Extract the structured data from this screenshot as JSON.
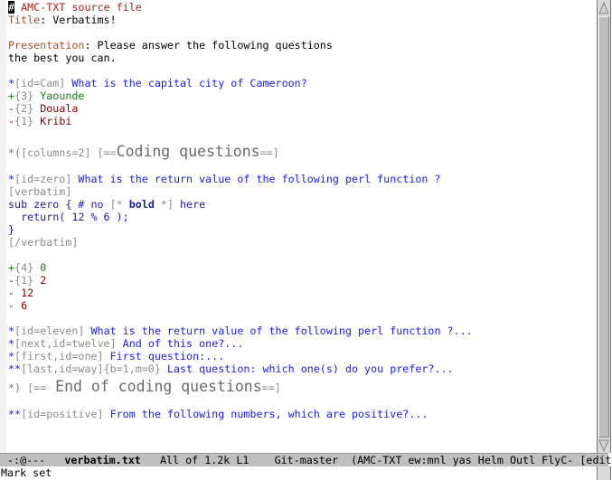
{
  "colors": {
    "question": "#1a1aff",
    "correct": "#1a7a1a",
    "wrong": "#8b0000",
    "comment": "#b22222",
    "keyword": "#a0522d",
    "code": "#1c1ca8",
    "options": "#8c8c8c"
  },
  "buffer": {
    "lines": [
      [
        {
          "t": "#",
          "c": "cur"
        },
        {
          "t": " AMC-TXT source file",
          "c": "r"
        }
      ],
      [
        {
          "t": "Title",
          "c": "k"
        },
        {
          "t": ": Verbatims!",
          "c": "t"
        }
      ],
      [],
      [
        {
          "t": "Presentation",
          "c": "k"
        },
        {
          "t": ": Please answer the following questions",
          "c": "t"
        }
      ],
      [
        {
          "t": "the best you can.",
          "c": "t"
        }
      ],
      [],
      [
        {
          "t": "*",
          "c": "q"
        },
        {
          "t": "[id=Cam]",
          "c": "o"
        },
        {
          "t": " What is the capital city of Cameroon?",
          "c": "q"
        }
      ],
      [
        {
          "t": "+",
          "c": "g"
        },
        {
          "t": "{3}",
          "c": "o"
        },
        {
          "t": " Yaounde",
          "c": "g"
        }
      ],
      [
        {
          "t": "-",
          "c": "w"
        },
        {
          "t": "{2}",
          "c": "o"
        },
        {
          "t": " Douala",
          "c": "w"
        }
      ],
      [
        {
          "t": "-",
          "c": "w"
        },
        {
          "t": "{1}",
          "c": "o"
        },
        {
          "t": " Kribi",
          "c": "w"
        }
      ],
      [],
      {
        "big": true,
        "segs": [
          {
            "t": "*(",
            "c": "ob"
          },
          {
            "t": "[columns=2]",
            "c": "o"
          },
          {
            "t": " [==",
            "c": "o"
          },
          {
            "t": "Coding questions",
            "c": "h"
          },
          {
            "t": "==]",
            "c": "o"
          }
        ]
      },
      [],
      [
        {
          "t": "*",
          "c": "q"
        },
        {
          "t": "[id=zero]",
          "c": "o"
        },
        {
          "t": " What is the return value of the following perl function ?",
          "c": "q"
        }
      ],
      [
        {
          "t": "[verbatim]",
          "c": "o"
        }
      ],
      [
        {
          "t": "sub zero { # no ",
          "c": "c"
        },
        {
          "t": "[*",
          "c": "o"
        },
        {
          "t": " bold ",
          "c": "cb"
        },
        {
          "t": "*]",
          "c": "o"
        },
        {
          "t": " here",
          "c": "c"
        }
      ],
      [
        {
          "t": "  return( 12 % 6 );",
          "c": "c"
        }
      ],
      [
        {
          "t": "}",
          "c": "c"
        }
      ],
      [
        {
          "t": "[/verbatim]",
          "c": "o"
        }
      ],
      [],
      [
        {
          "t": "+",
          "c": "g"
        },
        {
          "t": "{4}",
          "c": "o"
        },
        {
          "t": " 0",
          "c": "g"
        }
      ],
      [
        {
          "t": "-",
          "c": "w"
        },
        {
          "t": "{1}",
          "c": "o"
        },
        {
          "t": " 2",
          "c": "w"
        }
      ],
      [
        {
          "t": "-",
          "c": "w"
        },
        {
          "t": " 12",
          "c": "w"
        }
      ],
      [
        {
          "t": "-",
          "c": "w"
        },
        {
          "t": " 6",
          "c": "w"
        }
      ],
      [],
      [
        {
          "t": "*",
          "c": "q"
        },
        {
          "t": "[id=eleven]",
          "c": "o"
        },
        {
          "t": " What is the return value of the following perl function ?...",
          "c": "q"
        }
      ],
      [
        {
          "t": "*",
          "c": "q"
        },
        {
          "t": "[next,id=twelve]",
          "c": "o"
        },
        {
          "t": " And of this one?...",
          "c": "q"
        }
      ],
      [
        {
          "t": "*",
          "c": "q"
        },
        {
          "t": "[first,id=one]",
          "c": "o"
        },
        {
          "t": " First question:...",
          "c": "q"
        }
      ],
      [
        {
          "t": "**",
          "c": "q"
        },
        {
          "t": "[last,id=way]{b=1,m=0}",
          "c": "o"
        },
        {
          "t": " Last question: which one(s) do you prefer?...",
          "c": "q"
        }
      ],
      {
        "big": true,
        "segs": [
          {
            "t": "*)",
            "c": "ob"
          },
          {
            "t": " [==",
            "c": "o"
          },
          {
            "t": " End of coding questions",
            "c": "h"
          },
          {
            "t": "==]",
            "c": "o"
          }
        ]
      },
      [],
      [
        {
          "t": "**",
          "c": "q"
        },
        {
          "t": "[id=positive]",
          "c": "o"
        },
        {
          "t": " From the following numbers, which are positive?...",
          "c": "q"
        }
      ]
    ]
  },
  "modeline": {
    "status": "-:@---",
    "buffer_name": "verbatim.txt",
    "position": "All of 1.2k L1",
    "vc": "Git-master",
    "modes": "(AMC-TXT ew:mnl yas Helm Outl FlyC- [edit]"
  },
  "echo": "Mark set",
  "scrollbar": {
    "visible_fraction": 1.0,
    "position": 0
  }
}
